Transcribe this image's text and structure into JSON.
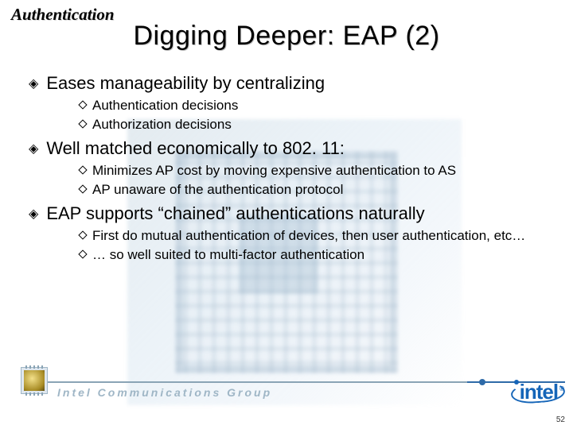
{
  "section_label": "Authentication",
  "title": "Digging Deeper: EAP (2)",
  "bullets": [
    {
      "text": "Eases manageability by centralizing",
      "sub": [
        "Authentication decisions",
        "Authorization decisions"
      ]
    },
    {
      "text": "Well matched economically to 802. 11:",
      "sub": [
        "Minimizes AP cost by moving expensive authentication to AS",
        "AP unaware of the authentication protocol"
      ]
    },
    {
      "text": "EAP supports “chained” authentications naturally",
      "sub": [
        "First do mutual authentication of devices, then user authentication, etc…",
        "… so well suited to multi-factor authentication"
      ]
    }
  ],
  "footer": {
    "group_name": "Intel Communications Group",
    "logo_text": "intel",
    "registered": "®"
  },
  "page_number": "52"
}
